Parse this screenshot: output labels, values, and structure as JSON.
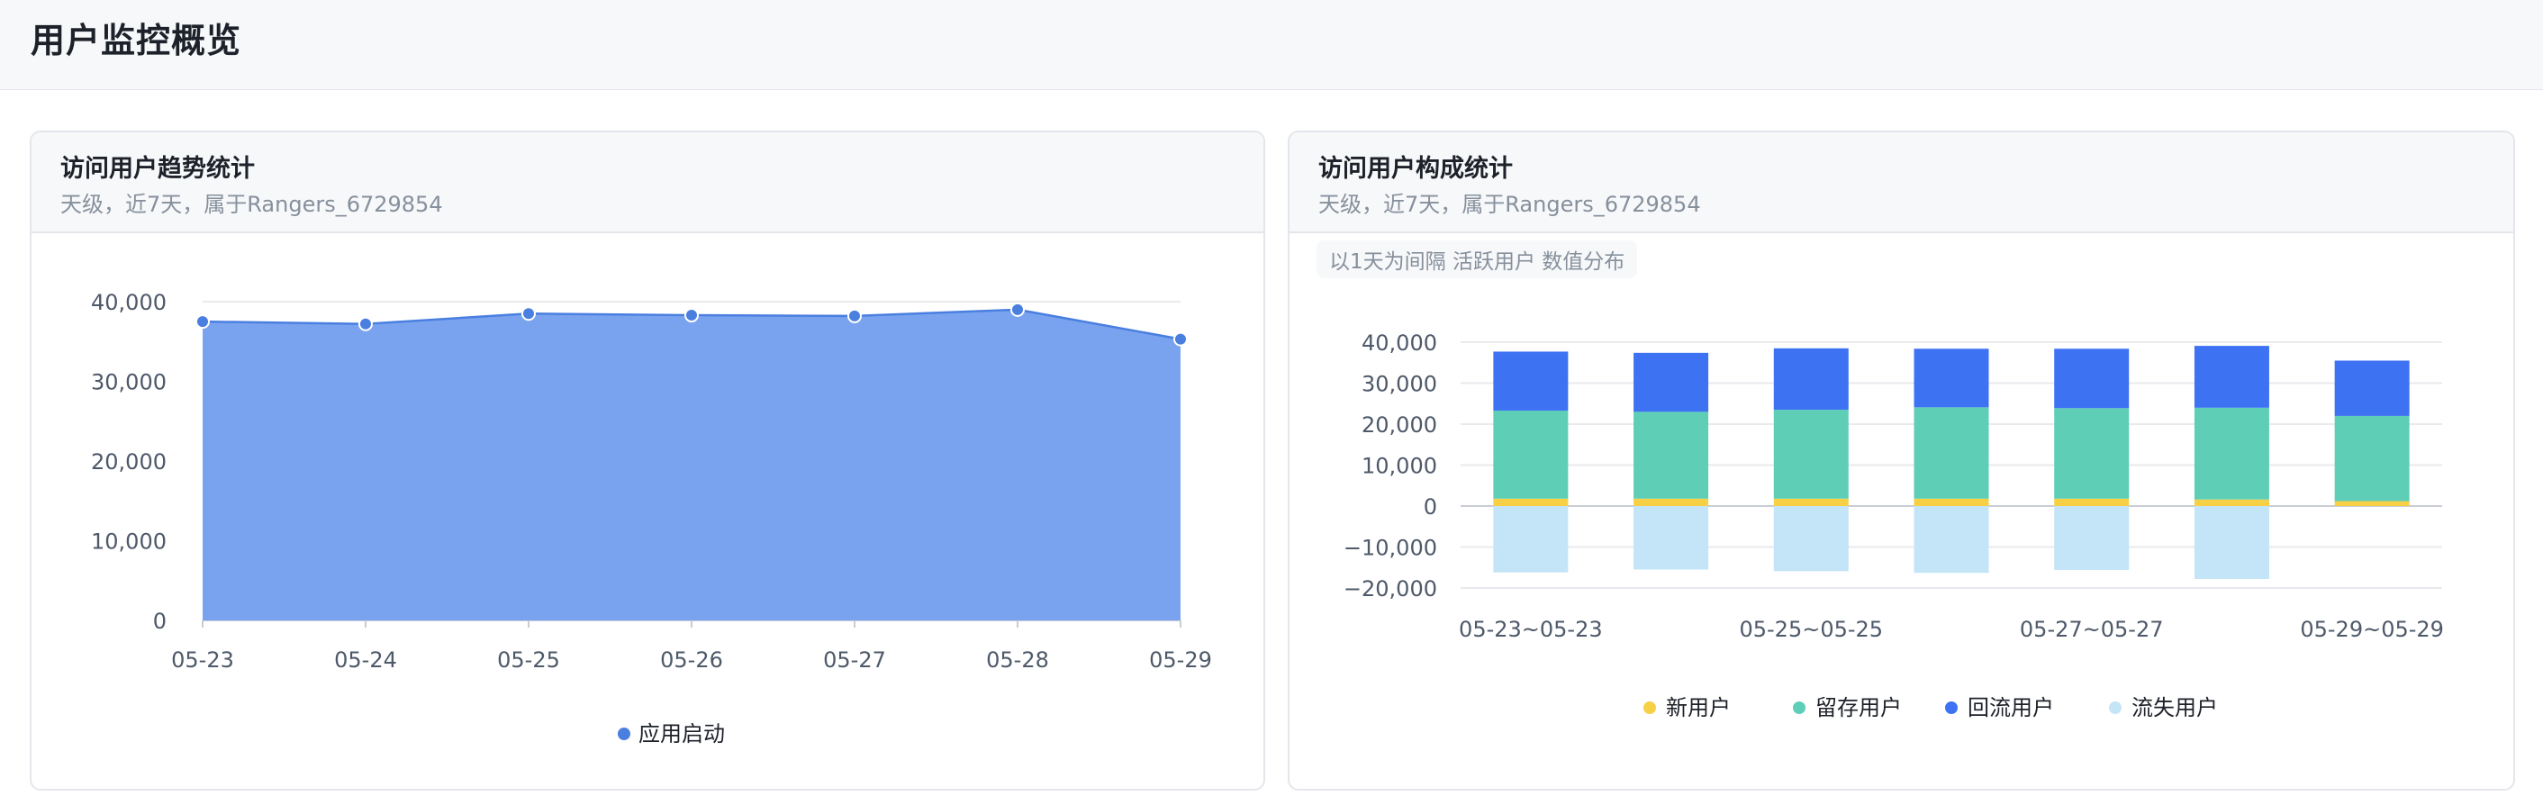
{
  "page": {
    "title": "用户监控概览"
  },
  "cards": [
    {
      "title": "访问用户趋势统计",
      "subtitle": "天级，近7天，属于Rangers_6729854"
    },
    {
      "title": "访问用户构成统计",
      "subtitle": "天级，近7天，属于Rangers_6729854",
      "chip": "以1天为间隔 活跃用户 数值分布"
    }
  ],
  "chart_data": [
    {
      "type": "area",
      "x": [
        "05-23",
        "05-24",
        "05-25",
        "05-26",
        "05-27",
        "05-28",
        "05-29"
      ],
      "series": [
        {
          "name": "应用启动",
          "values": [
            37500,
            37200,
            38500,
            38300,
            38200,
            39000,
            35300
          ],
          "color": "#4a7fe0"
        }
      ],
      "yticks": [
        0,
        10000,
        20000,
        30000,
        40000
      ],
      "ylim": [
        0,
        40000
      ],
      "grid": true,
      "legend": "bottom-center"
    },
    {
      "type": "bar",
      "stacked": true,
      "categories": [
        "05-23~05-23",
        "05-24~05-24",
        "05-25~05-25",
        "05-26~05-26",
        "05-27~05-27",
        "05-28~05-28",
        "05-29~05-29"
      ],
      "xtick_labels": [
        "05-23~05-23",
        "05-25~05-25",
        "05-27~05-27",
        "05-29~05-29"
      ],
      "series": [
        {
          "name": "新用户",
          "values": [
            1800,
            1800,
            1800,
            1800,
            1800,
            1600,
            1200
          ],
          "color": "#f7d046"
        },
        {
          "name": "留存用户",
          "values": [
            21500,
            21200,
            21700,
            22300,
            22100,
            22400,
            20800
          ],
          "color": "#5ecfb6"
        },
        {
          "name": "回流用户",
          "values": [
            14400,
            14400,
            15000,
            14300,
            14500,
            15100,
            13500
          ],
          "color": "#3d72f3"
        },
        {
          "name": "流失用户",
          "values": [
            -16200,
            -15500,
            -15900,
            -16300,
            -15600,
            -17800,
            0
          ],
          "color": "#c3e5f7"
        }
      ],
      "yticks": [
        -20000,
        -10000,
        0,
        10000,
        20000,
        30000,
        40000
      ],
      "ylim": [
        -20000,
        40000
      ],
      "grid": true,
      "legend": "bottom-center"
    }
  ]
}
